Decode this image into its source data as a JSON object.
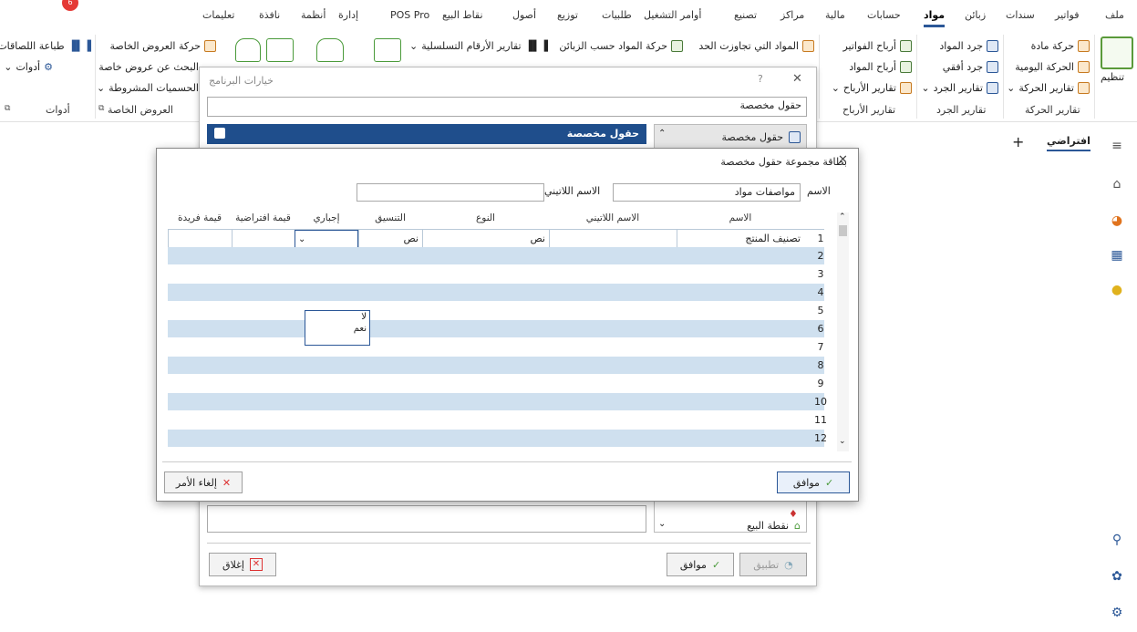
{
  "menu": {
    "items": [
      "ملف",
      "فواتير",
      "سندات",
      "زبائن",
      "مواد",
      "حسابات",
      "مالية",
      "مراكز",
      "تصنيع",
      "أوامر التشغيل",
      "طلبيات",
      "توزيع",
      "أصول",
      "نقاط البيع",
      "POS Pro",
      "إدارة",
      "أنظمة",
      "نافذة",
      "تعليمات"
    ],
    "active": "مواد",
    "badge": "6"
  },
  "ribbon": {
    "organize": "تنظيم",
    "group_movement": {
      "label": "تقارير الحركة",
      "items": [
        "حركة مادة",
        "الحركة اليومية",
        "تقارير الحركة"
      ]
    },
    "group_inventory": {
      "label": "تقارير الجرد",
      "items": [
        "جرد المواد",
        "جرد أفقي",
        "تقارير الجرد"
      ]
    },
    "group_profit": {
      "label": "تقارير الأرباح",
      "items": [
        "أرباح الفواتير",
        "أرباح المواد",
        "تقارير الأرباح"
      ]
    },
    "col4": [
      "المواد التي تجاوزت الحد"
    ],
    "col5": [
      "حركة المواد حسب الزبائن"
    ],
    "col6": [
      "تقارير الأرقام التسلسلية"
    ],
    "group_offers": {
      "label": "العروض الخاصة",
      "items": [
        "حركة العروض الخاصة",
        "البحث عن عروض خاصة",
        "الحسميات المشروطة"
      ]
    },
    "group_tools": {
      "label": "أدوات",
      "items": [
        "طباعة اللصاقات",
        "أدوات"
      ]
    }
  },
  "sidebar": {
    "tab_default": "افتراضي",
    "add": "+"
  },
  "options_window": {
    "title": "خيارات البرنامج",
    "search_value": "حقول مخصصة",
    "list_item_1": "حقول مخصصة",
    "list_item_pos": "نقطة البيع",
    "header_bar": "حقول مخصصة",
    "close": "إغلاق",
    "ok": "موافق",
    "apply": "تطبيق"
  },
  "card": {
    "title": "بطاقة مجموعة حقول مخصصة",
    "name_label": "الاسم",
    "name_value": "مواصفات مواد",
    "latin_label": "الاسم اللاتيني",
    "latin_value": "",
    "columns": [
      "الاسم",
      "الاسم اللاتيني",
      "النوع",
      "التنسيق",
      "إجباري",
      "قيمة افتراضية",
      "قيمة فريدة"
    ],
    "rows": [
      {
        "num": "1",
        "name": "تصنيف المنتج",
        "latin": "",
        "type": "نص",
        "format": "نص",
        "required": "",
        "default": "",
        "unique": ""
      },
      {
        "num": "2"
      },
      {
        "num": "3"
      },
      {
        "num": "4"
      },
      {
        "num": "5"
      },
      {
        "num": "6"
      },
      {
        "num": "7"
      },
      {
        "num": "8"
      },
      {
        "num": "9"
      },
      {
        "num": "10"
      },
      {
        "num": "11"
      },
      {
        "num": "12"
      }
    ],
    "dropdown_options": [
      "لا",
      "نعم"
    ],
    "ok": "موافق",
    "cancel": "إلغاء الأمر"
  }
}
